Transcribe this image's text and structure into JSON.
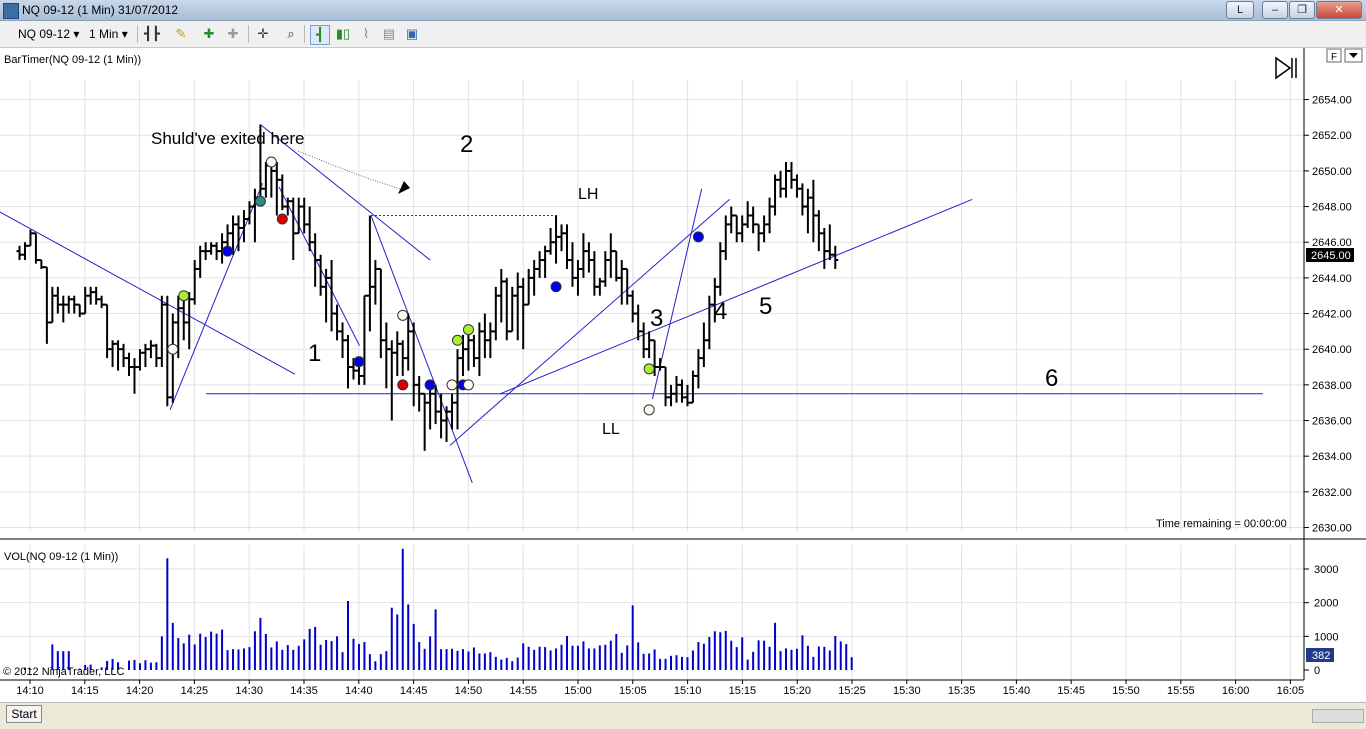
{
  "window": {
    "title": "NQ 09-12 (1 Min)  31/07/2012",
    "btn_l": "L",
    "minimize": "–",
    "restore": "❐",
    "close": "✕"
  },
  "toolbar": {
    "instrument": "NQ 09-12",
    "interval": "1 Min"
  },
  "panels": {
    "price_label": "BarTimer(NQ 09-12 (1 Min))",
    "volume_label": "VOL(NQ 09-12 (1 Min))",
    "time_remaining": "Time remaining = 00:00:00",
    "copyright": "© 2012 NinjaTrader, LLC",
    "f_button": "F"
  },
  "annotations": {
    "exit_note": "Shuld've exited here",
    "n1": "1",
    "n2": "2",
    "n3": "3",
    "n4": "4",
    "n5": "5",
    "n6": "6",
    "lh": "LH",
    "ll": "LL"
  },
  "status": {
    "start": "Start"
  },
  "colors": {
    "bar": "#000000",
    "trend": "#2222cc",
    "volume": "#0000cc",
    "price_box": "#000000",
    "vol_box": "#1f3c8a",
    "lh_line": "#cc0000",
    "dot_blue": "#0000ee",
    "dot_red": "#dd0000",
    "dot_green": "#aaee33",
    "dot_teal": "#2b8a8a",
    "dot_white": "#fffaf0"
  },
  "chart_data": {
    "type": "ohlc",
    "title": "NQ 09-12 (1 Min)",
    "last_price": "2645.00",
    "last_volume": "382",
    "price_ylim": [
      2629.5,
      2656.5
    ],
    "price_ticks": [
      "2630.00",
      "2632.00",
      "2634.00",
      "2636.00",
      "2638.00",
      "2640.00",
      "2642.00",
      "2644.00",
      "2646.00",
      "2648.00",
      "2650.00",
      "2652.00",
      "2654.00"
    ],
    "volume_ylim": [
      0,
      3450
    ],
    "volume_ticks": [
      "0",
      "1000",
      "2000",
      "3000"
    ],
    "time_ticks": [
      "14:10",
      "14:15",
      "14:20",
      "14:25",
      "14:30",
      "14:35",
      "14:40",
      "14:45",
      "14:50",
      "14:55",
      "15:00",
      "15:05",
      "15:10",
      "15:15",
      "15:20",
      "15:25",
      "15:30",
      "15:35",
      "15:40",
      "15:45",
      "15:50",
      "15:55",
      "16:00",
      "16:05"
    ],
    "first_bar": "14:08",
    "bars": [
      [
        2645.5,
        2645.8,
        2645.0,
        2645.3
      ],
      [
        2645.3,
        2646.0,
        2645.0,
        2645.8
      ],
      [
        2645.8,
        2646.7,
        2645.8,
        2646.5
      ],
      [
        2646.5,
        2646.5,
        2644.8,
        2645.0
      ],
      [
        2645.0,
        2645.0,
        2644.5,
        2644.6
      ],
      [
        2644.6,
        2644.6,
        2640.3,
        2641.5
      ],
      [
        2641.5,
        2643.5,
        2641.5,
        2643.0
      ],
      [
        2643.0,
        2643.5,
        2642.0,
        2642.5
      ],
      [
        2642.5,
        2643.0,
        2641.5,
        2642.5
      ],
      [
        2642.5,
        2643.0,
        2642.0,
        2642.8
      ],
      [
        2642.8,
        2643.0,
        2642.0,
        2642.5
      ],
      [
        2642.5,
        2642.5,
        2641.8,
        2642.0
      ],
      [
        2642.0,
        2643.5,
        2642.0,
        2643.0
      ],
      [
        2643.0,
        2643.5,
        2642.5,
        2643.2
      ],
      [
        2643.2,
        2643.5,
        2642.5,
        2642.8
      ],
      [
        2642.8,
        2643.0,
        2642.3,
        2642.5
      ],
      [
        2642.5,
        2642.5,
        2639.5,
        2640.0
      ],
      [
        2640.0,
        2640.5,
        2639.0,
        2640.3
      ],
      [
        2640.3,
        2640.5,
        2638.8,
        2640.0
      ],
      [
        2640.0,
        2640.3,
        2639.0,
        2639.5
      ],
      [
        2639.5,
        2639.8,
        2638.5,
        2639.0
      ],
      [
        2639.0,
        2639.5,
        2637.5,
        2639.0
      ],
      [
        2639.0,
        2640.0,
        2638.8,
        2639.8
      ],
      [
        2639.8,
        2640.3,
        2639.0,
        2640.0
      ],
      [
        2640.0,
        2640.5,
        2639.5,
        2640.2
      ],
      [
        2640.2,
        2640.3,
        2639.0,
        2639.5
      ],
      [
        2639.5,
        2643.0,
        2639.0,
        2642.5
      ],
      [
        2642.5,
        2643.0,
        2636.8,
        2637.3
      ],
      [
        2637.3,
        2642.0,
        2637.0,
        2641.5
      ],
      [
        2641.5,
        2643.0,
        2639.5,
        2642.3
      ],
      [
        2642.3,
        2642.8,
        2640.5,
        2641.5
      ],
      [
        2641.5,
        2643.2,
        2640.0,
        2642.8
      ],
      [
        2642.8,
        2645.0,
        2642.5,
        2644.5
      ],
      [
        2644.5,
        2645.8,
        2644.0,
        2645.5
      ],
      [
        2645.5,
        2646.0,
        2645.0,
        2645.5
      ],
      [
        2645.5,
        2646.0,
        2645.3,
        2645.8
      ],
      [
        2645.8,
        2646.0,
        2645.0,
        2645.5
      ],
      [
        2645.5,
        2646.5,
        2644.8,
        2646.0
      ],
      [
        2646.0,
        2647.0,
        2645.5,
        2646.5
      ],
      [
        2646.5,
        2647.5,
        2645.3,
        2647.0
      ],
      [
        2647.0,
        2647.5,
        2645.5,
        2646.8
      ],
      [
        2646.8,
        2647.8,
        2646.0,
        2647.3
      ],
      [
        2647.3,
        2648.3,
        2647.0,
        2648.0
      ],
      [
        2648.0,
        2649.0,
        2646.0,
        2648.5
      ],
      [
        2648.5,
        2652.6,
        2648.0,
        2649.0
      ],
      [
        2649.0,
        2650.5,
        2648.5,
        2650.3
      ],
      [
        2650.3,
        2650.8,
        2648.5,
        2650.0
      ],
      [
        2650.0,
        2650.5,
        2647.5,
        2649.5
      ],
      [
        2649.5,
        2649.8,
        2647.8,
        2648.0
      ],
      [
        2648.0,
        2648.5,
        2647.5,
        2648.3
      ],
      [
        2648.3,
        2648.5,
        2645.0,
        2646.5
      ],
      [
        2646.5,
        2648.5,
        2646.5,
        2648.0
      ],
      [
        2648.0,
        2648.5,
        2646.5,
        2647.0
      ],
      [
        2647.0,
        2648.0,
        2645.5,
        2646.0
      ],
      [
        2646.0,
        2646.5,
        2643.5,
        2645.0
      ],
      [
        2645.0,
        2645.3,
        2643.0,
        2643.5
      ],
      [
        2643.5,
        2644.5,
        2641.5,
        2644.0
      ],
      [
        2644.0,
        2645.0,
        2641.0,
        2642.0
      ],
      [
        2642.0,
        2642.5,
        2640.5,
        2641.0
      ],
      [
        2641.0,
        2641.5,
        2639.5,
        2640.5
      ],
      [
        2640.5,
        2640.8,
        2637.8,
        2639.0
      ],
      [
        2639.0,
        2639.5,
        2638.3,
        2638.8
      ],
      [
        2638.8,
        2639.3,
        2638.0,
        2638.5
      ],
      [
        2638.5,
        2643.0,
        2638.0,
        2643.0
      ],
      [
        2643.0,
        2647.5,
        2641.0,
        2643.5
      ],
      [
        2643.5,
        2645.0,
        2642.5,
        2644.5
      ],
      [
        2644.5,
        2644.5,
        2639.5,
        2640.5
      ],
      [
        2640.5,
        2641.5,
        2637.8,
        2640.0
      ],
      [
        2640.0,
        2640.5,
        2636.0,
        2639.8
      ],
      [
        2639.8,
        2641.0,
        2638.5,
        2640.3
      ],
      [
        2640.3,
        2640.5,
        2638.5,
        2639.5
      ],
      [
        2639.5,
        2642.0,
        2638.8,
        2641.0
      ],
      [
        2641.0,
        2641.5,
        2636.8,
        2638.0
      ],
      [
        2638.0,
        2638.5,
        2636.5,
        2637.5
      ],
      [
        2637.5,
        2637.5,
        2634.3,
        2637.0
      ],
      [
        2637.0,
        2638.0,
        2635.5,
        2637.5
      ],
      [
        2637.5,
        2638.0,
        2635.8,
        2636.5
      ],
      [
        2636.5,
        2637.5,
        2635.0,
        2636.0
      ],
      [
        2636.0,
        2636.8,
        2634.8,
        2636.5
      ],
      [
        2636.5,
        2637.5,
        2635.5,
        2637.0
      ],
      [
        2637.0,
        2640.0,
        2635.5,
        2639.5
      ],
      [
        2639.5,
        2640.8,
        2638.5,
        2640.0
      ],
      [
        2640.0,
        2641.0,
        2638.8,
        2640.5
      ],
      [
        2640.5,
        2640.8,
        2639.0,
        2639.5
      ],
      [
        2639.5,
        2641.5,
        2638.5,
        2641.0
      ],
      [
        2641.0,
        2642.0,
        2639.5,
        2640.5
      ],
      [
        2640.5,
        2641.5,
        2639.5,
        2641.0
      ],
      [
        2641.0,
        2643.5,
        2640.5,
        2643.0
      ],
      [
        2643.0,
        2644.5,
        2641.5,
        2643.8
      ],
      [
        2643.8,
        2644.0,
        2640.5,
        2641.0
      ],
      [
        2641.0,
        2643.5,
        2641.0,
        2643.0
      ],
      [
        2643.0,
        2644.3,
        2640.5,
        2643.5
      ],
      [
        2643.5,
        2644.0,
        2640.0,
        2642.5
      ],
      [
        2642.5,
        2644.5,
        2642.5,
        2644.0
      ],
      [
        2644.0,
        2645.0,
        2643.0,
        2644.5
      ],
      [
        2644.5,
        2645.5,
        2644.0,
        2645.0
      ],
      [
        2645.0,
        2645.8,
        2644.0,
        2645.5
      ],
      [
        2645.5,
        2646.8,
        2645.3,
        2646.0
      ],
      [
        2646.0,
        2647.5,
        2644.8,
        2646.3
      ],
      [
        2646.3,
        2647.0,
        2645.5,
        2646.5
      ],
      [
        2646.5,
        2647.0,
        2644.5,
        2645.0
      ],
      [
        2645.0,
        2646.0,
        2643.5,
        2644.0
      ],
      [
        2644.0,
        2645.0,
        2643.0,
        2644.5
      ],
      [
        2644.5,
        2646.5,
        2644.0,
        2645.5
      ],
      [
        2645.5,
        2646.0,
        2644.3,
        2645.0
      ],
      [
        2645.0,
        2645.5,
        2643.0,
        2643.5
      ],
      [
        2643.5,
        2644.0,
        2643.0,
        2643.8
      ],
      [
        2643.8,
        2645.5,
        2643.5,
        2645.0
      ],
      [
        2645.0,
        2646.5,
        2644.0,
        2645.5
      ],
      [
        2645.5,
        2645.5,
        2643.8,
        2644.0
      ],
      [
        2644.0,
        2645.0,
        2642.5,
        2644.5
      ],
      [
        2644.5,
        2644.5,
        2642.5,
        2643.0
      ],
      [
        2643.0,
        2643.3,
        2641.5,
        2642.0
      ],
      [
        2642.0,
        2642.5,
        2640.5,
        2641.0
      ],
      [
        2641.0,
        2641.5,
        2639.5,
        2640.0
      ],
      [
        2640.0,
        2641.0,
        2639.5,
        2640.5
      ],
      [
        2640.5,
        2640.5,
        2638.5,
        2639.0
      ],
      [
        2639.0,
        2639.5,
        2638.8,
        2639.0
      ],
      [
        2639.0,
        2639.0,
        2636.8,
        2637.3
      ],
      [
        2637.3,
        2638.0,
        2636.8,
        2637.5
      ],
      [
        2637.5,
        2638.5,
        2637.0,
        2638.0
      ],
      [
        2638.0,
        2638.3,
        2637.0,
        2637.3
      ],
      [
        2637.3,
        2638.0,
        2636.8,
        2637.0
      ],
      [
        2637.0,
        2638.8,
        2637.0,
        2638.5
      ],
      [
        2638.5,
        2640.0,
        2637.8,
        2639.5
      ],
      [
        2639.5,
        2641.5,
        2639.0,
        2640.5
      ],
      [
        2640.5,
        2643.0,
        2640.0,
        2642.5
      ],
      [
        2642.5,
        2644.0,
        2641.5,
        2643.5
      ],
      [
        2643.5,
        2646.0,
        2643.0,
        2645.5
      ],
      [
        2645.5,
        2647.5,
        2645.0,
        2647.0
      ],
      [
        2647.0,
        2648.0,
        2646.5,
        2647.5
      ],
      [
        2647.5,
        2647.5,
        2646.0,
        2646.5
      ],
      [
        2646.5,
        2647.5,
        2646.0,
        2647.0
      ],
      [
        2647.0,
        2648.3,
        2646.8,
        2647.5
      ],
      [
        2647.5,
        2648.0,
        2646.5,
        2647.0
      ],
      [
        2647.0,
        2647.0,
        2645.5,
        2646.5
      ],
      [
        2646.5,
        2647.5,
        2646.0,
        2647.0
      ],
      [
        2647.0,
        2648.5,
        2646.5,
        2648.0
      ],
      [
        2648.0,
        2649.8,
        2647.5,
        2649.5
      ],
      [
        2649.5,
        2650.0,
        2648.5,
        2649.0
      ],
      [
        2649.0,
        2650.5,
        2648.5,
        2650.0
      ],
      [
        2650.0,
        2650.5,
        2649.0,
        2649.5
      ],
      [
        2649.5,
        2649.8,
        2648.5,
        2649.0
      ],
      [
        2649.0,
        2649.3,
        2647.5,
        2648.0
      ],
      [
        2648.0,
        2649.0,
        2646.5,
        2648.5
      ],
      [
        2648.5,
        2649.5,
        2646.0,
        2647.5
      ],
      [
        2647.5,
        2647.8,
        2645.5,
        2646.5
      ],
      [
        2646.5,
        2646.8,
        2644.5,
        2645.5
      ],
      [
        2645.5,
        2647.0,
        2645.0,
        2645.3
      ],
      [
        2645.3,
        2645.8,
        2644.5,
        2645.0
      ]
    ],
    "volumes": [
      0,
      70,
      40,
      0,
      0,
      0,
      760,
      560,
      560,
      560,
      0,
      40,
      150,
      160,
      0,
      80,
      270,
      330,
      230,
      0,
      280,
      300,
      200,
      290,
      220,
      230,
      1000,
      3320,
      1400,
      950,
      790,
      1050,
      760,
      1080,
      980,
      1140,
      1080,
      1200,
      590,
      620,
      610,
      640,
      680,
      1150,
      1550,
      1070,
      670,
      850,
      600,
      740,
      600,
      720,
      910,
      1220,
      1280,
      750,
      890,
      860,
      1000,
      530,
      2050,
      930,
      770,
      830,
      470,
      260,
      470,
      560,
      1850,
      1650,
      3600,
      1950,
      1370,
      830,
      630,
      1000,
      1800,
      620,
      620,
      630,
      570,
      620,
      550,
      670,
      490,
      490,
      530,
      390,
      310,
      360,
      260,
      370,
      790,
      690,
      600,
      690,
      680,
      580,
      640,
      750,
      1010,
      720,
      720,
      850,
      640,
      640,
      730,
      750,
      870,
      1070,
      510,
      730,
      1920,
      820,
      480,
      490,
      610,
      330,
      330,
      420,
      440,
      390,
      380,
      580,
      830,
      780,
      980,
      1150,
      1120,
      1160,
      870,
      680,
      970,
      310,
      540,
      880,
      870,
      690,
      1400,
      560,
      640,
      600,
      630,
      1030,
      720,
      390,
      700,
      690,
      580,
      1010,
      850,
      770,
      380
    ],
    "dots": [
      {
        "bar": 28,
        "price": 2640.0,
        "color": "white"
      },
      {
        "bar": 30,
        "price": 2643.0,
        "color": "green"
      },
      {
        "bar": 38,
        "price": 2645.5,
        "color": "blue"
      },
      {
        "bar": 44,
        "price": 2648.3,
        "color": "teal"
      },
      {
        "bar": 46,
        "price": 2650.5,
        "color": "white"
      },
      {
        "bar": 48,
        "price": 2647.3,
        "color": "red"
      },
      {
        "bar": 62,
        "price": 2639.3,
        "color": "blue"
      },
      {
        "bar": 70,
        "price": 2641.9,
        "color": "white"
      },
      {
        "bar": 70,
        "price": 2638.0,
        "color": "red"
      },
      {
        "bar": 75,
        "price": 2638.0,
        "color": "blue"
      },
      {
        "bar": 79,
        "price": 2638.0,
        "color": "white"
      },
      {
        "bar": 80,
        "price": 2640.5,
        "color": "green"
      },
      {
        "bar": 81,
        "price": 2638.0,
        "color": "blue"
      },
      {
        "bar": 82,
        "price": 2638.0,
        "color": "white"
      },
      {
        "bar": 82,
        "price": 2641.1,
        "color": "green"
      },
      {
        "bar": 98,
        "price": 2643.5,
        "color": "blue"
      },
      {
        "bar": 115,
        "price": 2636.6,
        "color": "white"
      },
      {
        "bar": 115,
        "price": 2638.9,
        "color": "green"
      },
      {
        "bar": 124,
        "price": 2646.3,
        "color": "blue"
      }
    ]
  }
}
